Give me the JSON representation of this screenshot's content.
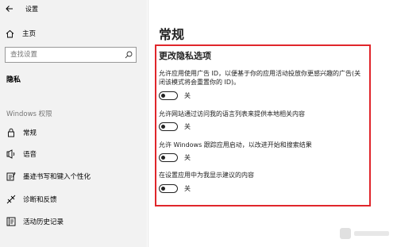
{
  "window": {
    "title": "设置"
  },
  "sidebar": {
    "home_label": "主页",
    "search_placeholder": "查找设置",
    "section_privacy": "隐私",
    "section_windows": "Windows 权限",
    "items": [
      {
        "label": "常规",
        "icon": "lock-icon",
        "active": true
      },
      {
        "label": "语音",
        "icon": "speech-icon",
        "active": false
      },
      {
        "label": "墨迹书写和键入个性化",
        "icon": "pen-keyboard-icon",
        "active": false
      },
      {
        "label": "诊断和反馈",
        "icon": "feedback-icon",
        "active": false
      },
      {
        "label": "活动历史记录",
        "icon": "activity-history-icon",
        "active": false
      }
    ]
  },
  "main": {
    "page_title": "常规",
    "section_title": "更改隐私选项",
    "options": [
      {
        "desc": "允许应用使用广告 ID，以便基于你的应用活动投放你更感兴趣的广告(关闭该模式将会重置你的 ID)。",
        "state": "关",
        "on": false
      },
      {
        "desc": "允许网站通过访问我的语言列表来提供本地相关内容",
        "state": "关",
        "on": false
      },
      {
        "desc": "允许 Windows 跟踪应用启动，以改进开始和搜索结果",
        "state": "关",
        "on": false
      },
      {
        "desc": "在设置应用中为我显示建议的内容",
        "state": "关",
        "on": false
      }
    ]
  },
  "colors": {
    "highlight_border": "#e0262b",
    "sidebar_bg": "#f2f2f2"
  }
}
